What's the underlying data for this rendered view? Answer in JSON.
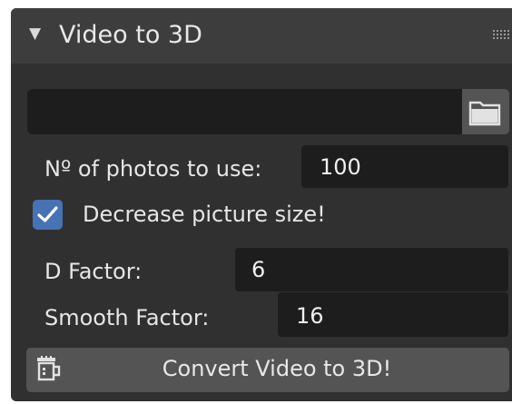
{
  "panel": {
    "title": "Video to 3D",
    "collapse_icon": "triangle-down-icon",
    "grip_icon": "drag-grip-icon"
  },
  "file_input": {
    "value": "",
    "browse_icon": "folder-icon"
  },
  "photos": {
    "label": "Nº of photos to use:",
    "value": "100"
  },
  "decrease": {
    "label": "Decrease picture size!",
    "checked": true
  },
  "d_factor": {
    "label": "D Factor:",
    "value": "6"
  },
  "smooth_factor": {
    "label": "Smooth Factor:",
    "value": "16"
  },
  "convert": {
    "label": "Convert Video to 3D!",
    "icon": "film-reel-icon"
  },
  "colors": {
    "panel_bg": "#303030",
    "header_bg": "#3d3d3d",
    "field_bg": "#1d1d1d",
    "button_bg": "#545454",
    "checkbox_accent": "#4772b3"
  }
}
